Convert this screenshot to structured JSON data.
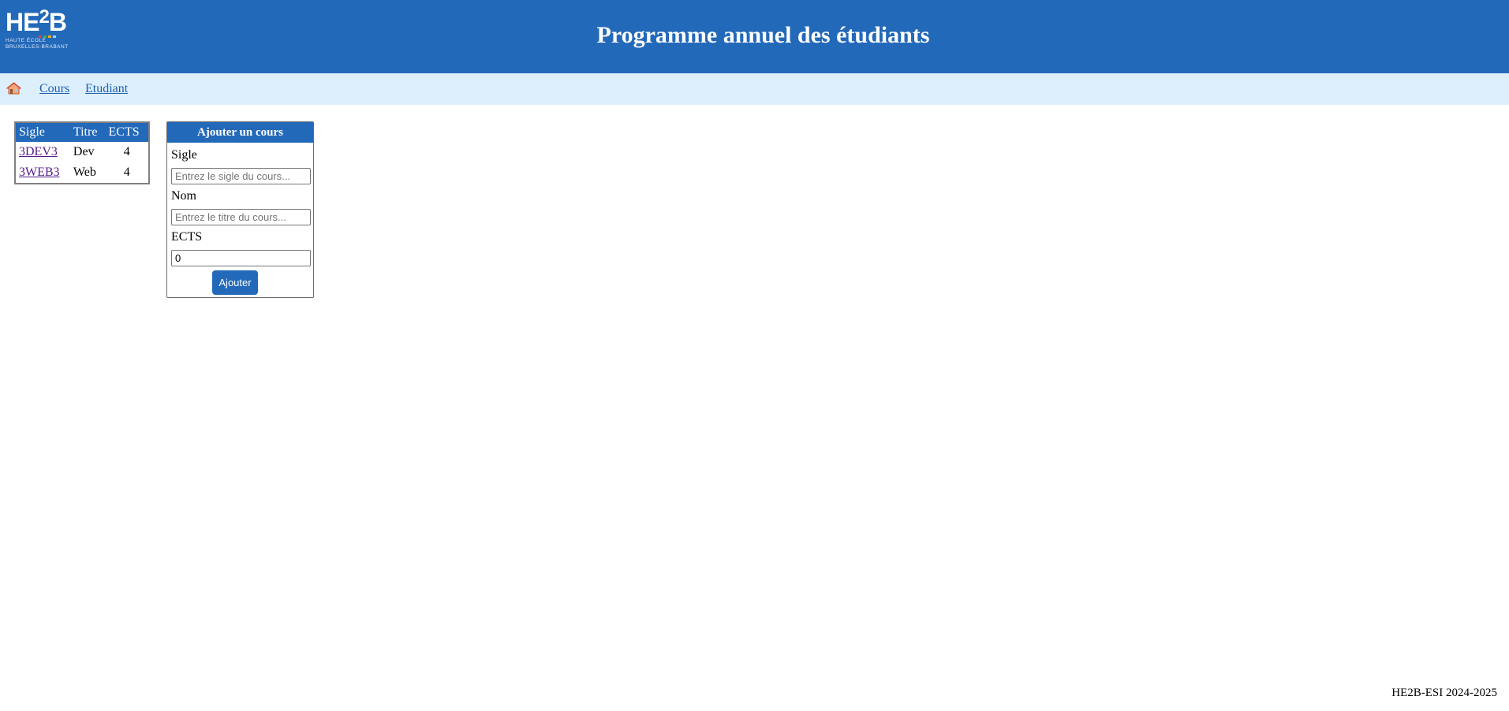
{
  "header": {
    "logo": {
      "mark_prefix": "HE",
      "mark_two": "2",
      "mark_suffix": "B",
      "line1": "HAUTE ÉCOLE",
      "line2": "BRUXELLES-BRABANT",
      "dot_colors": [
        "#e2452f",
        "#3fae49",
        "#f6a821",
        "#8fd3f4"
      ]
    },
    "title": "Programme annuel des étudiants",
    "color": "#2369b9"
  },
  "nav": {
    "home_icon": "home-icon",
    "items": [
      {
        "label": "Cours"
      },
      {
        "label": "Etudiant"
      }
    ]
  },
  "courses": {
    "headers": [
      "Sigle",
      "Titre",
      "ECTS"
    ],
    "rows": [
      {
        "sigle": "3DEV3",
        "titre": "Dev",
        "ects": "4"
      },
      {
        "sigle": "3WEB3",
        "titre": "Web",
        "ects": "4"
      }
    ]
  },
  "form": {
    "title": "Ajouter un cours",
    "sigle_label": "Sigle",
    "sigle_placeholder": "Entrez le sigle du cours...",
    "nom_label": "Nom",
    "nom_placeholder": "Entrez le titre du cours...",
    "ects_label": "ECTS",
    "ects_value": "0",
    "submit_label": "Ajouter"
  },
  "footer": {
    "text": "HE2B-ESI 2024-2025"
  }
}
